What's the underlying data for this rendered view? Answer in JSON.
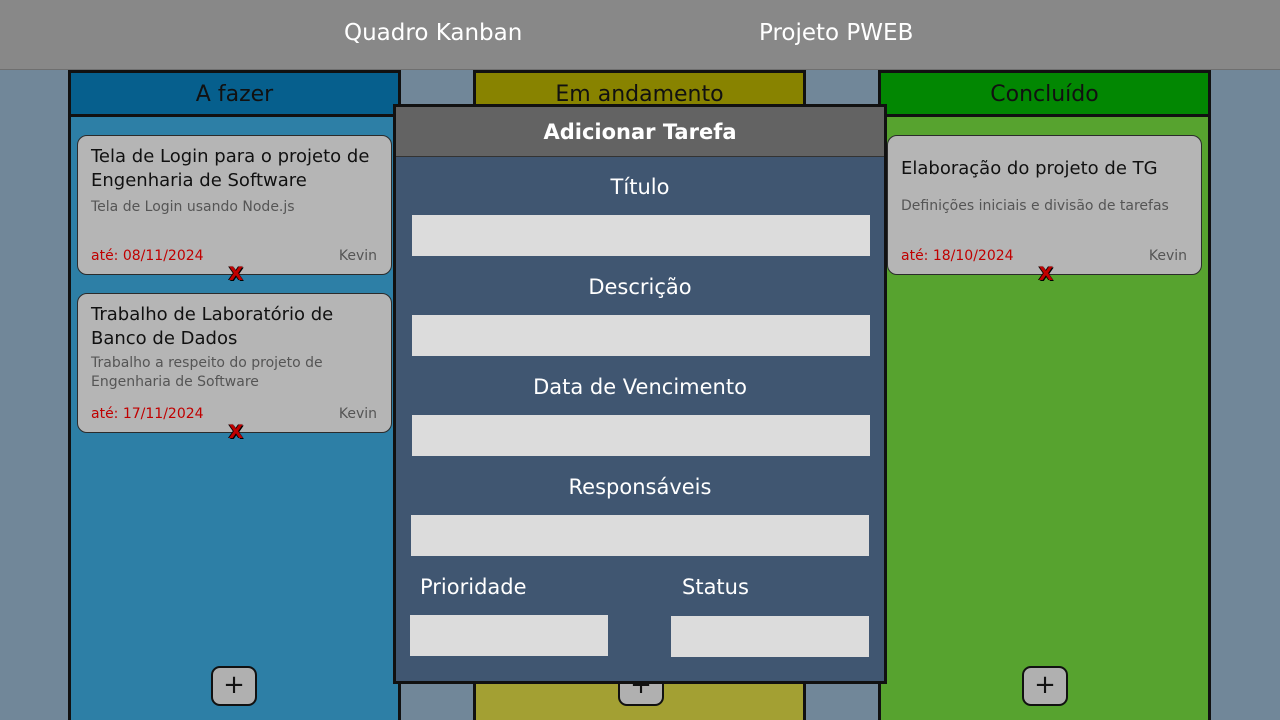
{
  "header": {
    "left_title": "Quadro Kanban",
    "right_title": "Projeto PWEB"
  },
  "columns": [
    {
      "title": "A fazer",
      "color": "#2d7fa6",
      "header_color": "#065f8d",
      "add_label": "+",
      "cards": [
        {
          "title": "Tela de Login para o projeto de Engenharia de Software",
          "description": "Tela de Login usando Node.js",
          "due": "até: 08/11/2024",
          "owner": "Kevin",
          "delete_label": "X"
        },
        {
          "title": "Trabalho de Laboratório de Banco de Dados",
          "description": "Trabalho a respeito do projeto de Engenharia de Software",
          "due": "até: 17/11/2024",
          "owner": "Kevin",
          "delete_label": "X"
        }
      ]
    },
    {
      "title": "Em andamento",
      "color": "#a3a033",
      "header_color": "#888300",
      "add_label": "+",
      "cards": []
    },
    {
      "title": "Concluído",
      "color": "#57a32f",
      "header_color": "#028702",
      "add_label": "+",
      "cards": [
        {
          "title": "Elaboração do projeto de TG",
          "description": "Definições iniciais e divisão de tarefas",
          "due": "até: 18/10/2024",
          "owner": "Kevin",
          "delete_label": "X"
        }
      ]
    }
  ],
  "modal": {
    "title": "Adicionar Tarefa",
    "labels": {
      "title": "Título",
      "description": "Descrição",
      "due_date": "Data de Vencimento",
      "assignees": "Responsáveis",
      "priority": "Prioridade",
      "status": "Status"
    },
    "values": {
      "title": "",
      "description": "",
      "due_date": "",
      "assignees": "",
      "priority": "",
      "status": ""
    }
  },
  "colors": {
    "background": "#718799",
    "topbar": "#888888",
    "modal": "#405671",
    "modal_header": "#636363",
    "due_date_text": "#c00000"
  }
}
